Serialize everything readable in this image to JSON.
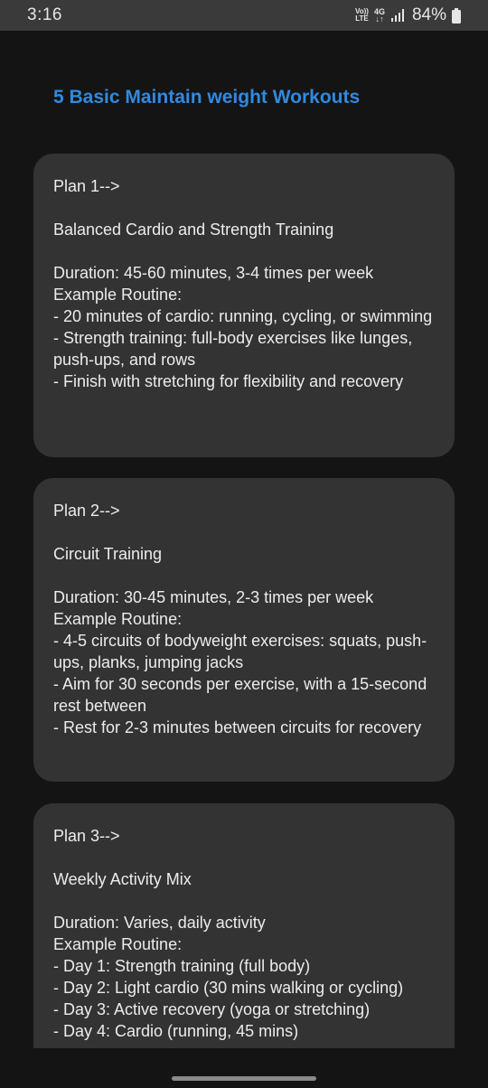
{
  "status_bar": {
    "time": "3:16",
    "volte_top": "Vo))",
    "volte_bottom": "LTE",
    "net_top": "4G",
    "net_bottom": "↓↑",
    "battery": "84%",
    "icons": [
      "signal-icon",
      "battery-icon"
    ]
  },
  "page": {
    "title": "5 Basic Maintain weight Workouts",
    "accent_color": "#2f8ae0"
  },
  "plans": [
    {
      "heading": "Plan 1-->",
      "name": "Balanced Cardio and Strength Training",
      "lines": [
        "Duration: 45-60 minutes, 3-4 times per week",
        "Example Routine:",
        "- 20 minutes of cardio: running, cycling, or swimming",
        "- Strength training: full-body exercises like lunges, push-ups, and rows",
        "- Finish with stretching for flexibility and recovery"
      ]
    },
    {
      "heading": "Plan 2-->",
      "name": "Circuit Training",
      "lines": [
        "Duration: 30-45 minutes, 2-3 times per week",
        "Example Routine:",
        "- 4-5 circuits of bodyweight exercises: squats, push-ups, planks, jumping jacks",
        "- Aim for 30 seconds per exercise, with a 15-second rest between",
        "- Rest for 2-3 minutes between circuits for recovery"
      ]
    },
    {
      "heading": "Plan 3-->",
      "name": "Weekly Activity Mix",
      "lines": [
        "Duration: Varies, daily activity",
        "Example Routine:",
        "- Day 1: Strength training (full body)",
        "- Day 2: Light cardio (30 mins walking or cycling)",
        "- Day 3: Active recovery (yoga or stretching)",
        "- Day 4: Cardio (running, 45 mins)"
      ]
    }
  ]
}
